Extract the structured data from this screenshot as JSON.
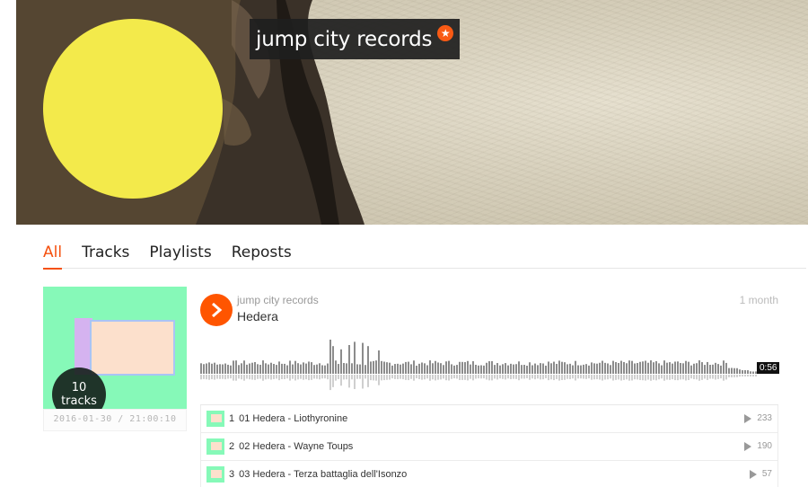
{
  "profile": {
    "username": "jump city records",
    "badge_icon": "pro-star-icon",
    "avatar_color": "#f3ea4b"
  },
  "tabs": [
    {
      "label": "All",
      "active": true
    },
    {
      "label": "Tracks",
      "active": false
    },
    {
      "label": "Playlists",
      "active": false
    },
    {
      "label": "Reposts",
      "active": false
    }
  ],
  "playlist": {
    "track_count": "10",
    "track_count_label": "tracks",
    "date": "2016-01-30 / 21:00:10",
    "uploader": "jump city records",
    "title": "Hedera",
    "age": "1 month",
    "duration": "0:56",
    "accent_color": "#ff5500"
  },
  "tracks": [
    {
      "num": "1",
      "name": "01 Hedera - Liothyronine",
      "plays": "233"
    },
    {
      "num": "2",
      "name": "02 Hedera - Wayne Toups",
      "plays": "190"
    },
    {
      "num": "3",
      "name": "03 Hedera - Terza battaglia dell'Isonzo",
      "plays": "57"
    }
  ]
}
